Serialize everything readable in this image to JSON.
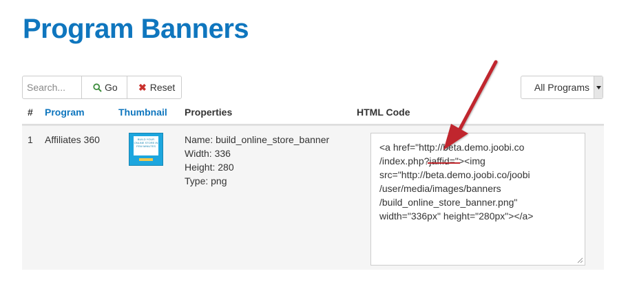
{
  "page": {
    "title": "Program Banners"
  },
  "toolbar": {
    "search_placeholder": "Search...",
    "go_label": "Go",
    "reset_label": "Reset",
    "program_filter": "All Programs"
  },
  "table": {
    "headers": {
      "num": "#",
      "program": "Program",
      "thumbnail": "Thumbnail",
      "properties": "Properties",
      "html_code": "HTML Code"
    },
    "rows": [
      {
        "num": "1",
        "program": "Affiliates 360",
        "thumbnail_text": "BUILD YOUR ONLINE STORE IN FEW MINUTES",
        "properties": {
          "name": "Name: build_online_store_banner",
          "width": "Width: 336",
          "height": "Height: 280",
          "type": "Type: png"
        },
        "html_code_lines": [
          "<a href=\"http://beta.demo.joobi.co",
          "/index.php?jaffid=\"><img",
          "src=\"http://beta.demo.joobi.co/joobi",
          "/user/media/images/banners",
          "/build_online_store_banner.png\"",
          "width=\"336px\" height=\"280px\"></a>"
        ]
      }
    ]
  },
  "colors": {
    "title_blue": "#0f76be",
    "go_icon": "#3c8c3c",
    "reset_icon": "#c9302c",
    "annotation_red": "#c0272d"
  },
  "icons": {
    "go": "magnifier-icon",
    "reset": "x-icon",
    "select": "caret-down-icon",
    "annotation": "arrow-annotation"
  }
}
